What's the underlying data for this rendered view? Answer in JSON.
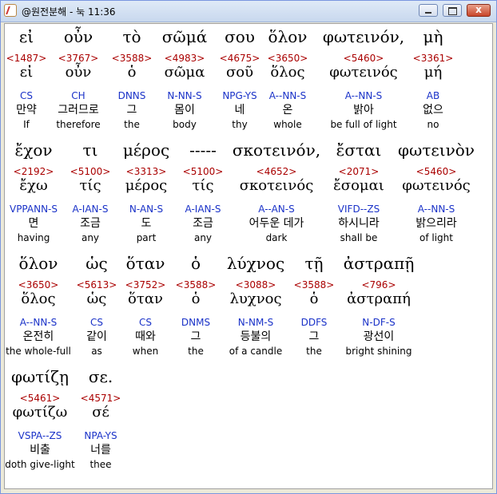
{
  "window": {
    "title": "@원전분해 - 눅 11:36",
    "close_glyph": "x"
  },
  "rows": [
    [
      {
        "greek": "εἰ",
        "strong": "<1487>",
        "lemma": "εἰ",
        "morph": "CS",
        "korean": "만약",
        "english": "If"
      },
      {
        "greek": "οὖν",
        "strong": "<3767>",
        "lemma": "οὖν",
        "morph": "CH",
        "korean": "그러므로",
        "english": "therefore"
      },
      {
        "greek": "τὸ",
        "strong": "<3588>",
        "lemma": "ὁ",
        "morph": "DNNS",
        "korean": "그",
        "english": "the"
      },
      {
        "greek": "σῶμά",
        "strong": "<4983>",
        "lemma": "σῶμα",
        "morph": "N-NN-S",
        "korean": "몸이",
        "english": "body"
      },
      {
        "greek": "σου",
        "strong": "<4675>",
        "lemma": "σοῦ",
        "morph": "NPG-YS",
        "korean": "네",
        "english": "thy"
      },
      {
        "greek": "ὅλον",
        "strong": "<3650>",
        "lemma": "ὅλος",
        "morph": "A--NN-S",
        "korean": "온",
        "english": "whole"
      },
      {
        "greek": "φωτεινόν,",
        "strong": "<5460>",
        "lemma": "φωτεινός",
        "morph": "A--NN-S",
        "korean": "밝아",
        "english": "be full of light"
      },
      {
        "greek": "μὴ",
        "strong": "<3361>",
        "lemma": "μή",
        "morph": "AB",
        "korean": "없으",
        "english": "no"
      }
    ],
    [
      {
        "greek": "ἔχον",
        "strong": "<2192>",
        "lemma": "ἔχω",
        "morph": "VPPANN-S",
        "korean": "면",
        "english": "having"
      },
      {
        "greek": "τι",
        "strong": "<5100>",
        "lemma": "τίς",
        "morph": "A-IAN-S",
        "korean": "조금",
        "english": "any"
      },
      {
        "greek": "μέρος",
        "strong": "<3313>",
        "lemma": "μέρος",
        "morph": "N-AN-S",
        "korean": "도",
        "english": "part"
      },
      {
        "greek": "-----",
        "strong": "<5100>",
        "lemma": "τίς",
        "morph": "A-IAN-S",
        "korean": "조금",
        "english": "any"
      },
      {
        "greek": "σκοτεινόν,",
        "strong": "<4652>",
        "lemma": "σκοτεινός",
        "morph": "A--AN-S",
        "korean": "어두운 데가",
        "english": "dark"
      },
      {
        "greek": "ἔσται",
        "strong": "<2071>",
        "lemma": "ἔσομαι",
        "morph": "VIFD--ZS",
        "korean": "하시니라",
        "english": "shall be"
      },
      {
        "greek": "φωτεινὸν",
        "strong": "<5460>",
        "lemma": "φωτεινός",
        "morph": "A--NN-S",
        "korean": "밝으리라",
        "english": "of light"
      }
    ],
    [
      {
        "greek": "ὅλον",
        "strong": "<3650>",
        "lemma": "ὅλος",
        "morph": "A--NN-S",
        "korean": "온전히",
        "english": "the whole-full"
      },
      {
        "greek": "ὡς",
        "strong": "<5613>",
        "lemma": "ὡς",
        "morph": "CS",
        "korean": "같이",
        "english": "as"
      },
      {
        "greek": "ὅταν",
        "strong": "<3752>",
        "lemma": "ὅταν",
        "morph": "CS",
        "korean": "때와",
        "english": "when"
      },
      {
        "greek": "ὁ",
        "strong": "<3588>",
        "lemma": "ὁ",
        "morph": "DNMS",
        "korean": "그",
        "english": "the"
      },
      {
        "greek": "λύχνος",
        "strong": "<3088>",
        "lemma": "λυχνος",
        "morph": "N-NM-S",
        "korean": "등불의",
        "english": "of a candle"
      },
      {
        "greek": "τῇ",
        "strong": "<3588>",
        "lemma": "ὁ",
        "morph": "DDFS",
        "korean": "그",
        "english": "the"
      },
      {
        "greek": "ἀστραπῇ",
        "strong": "<796>",
        "lemma": "ἀστραπή",
        "morph": "N-DF-S",
        "korean": "광선이",
        "english": "bright shining"
      }
    ],
    [
      {
        "greek": "φωτίζῃ",
        "strong": "<5461>",
        "lemma": "φωτίζω",
        "morph": "VSPA--ZS",
        "korean": "비출",
        "english": "doth give-light"
      },
      {
        "greek": "σε.",
        "strong": "<4571>",
        "lemma": "σέ",
        "morph": "NPA-YS",
        "korean": "너를",
        "english": "thee"
      }
    ]
  ],
  "colors": {
    "strong": "#aa0000",
    "morph": "#1a32c8"
  }
}
